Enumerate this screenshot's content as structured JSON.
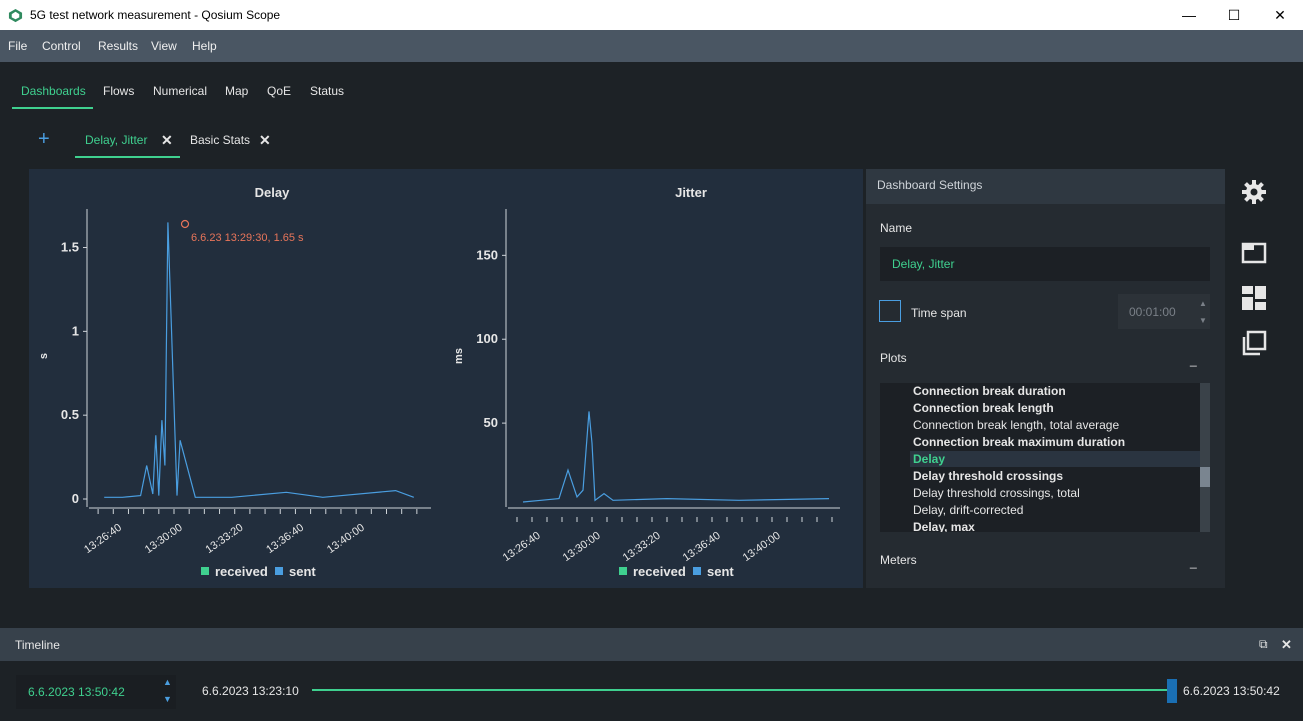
{
  "window": {
    "title": "5G test network measurement - Qosium Scope",
    "minimize": "—",
    "maximize": "☐",
    "close": "✕"
  },
  "menu": [
    "File",
    "Control",
    "Results",
    "View",
    "Help"
  ],
  "main_tabs": [
    "Dashboards",
    "Flows",
    "Numerical",
    "Map",
    "QoE",
    "Status"
  ],
  "dashboard_tabs": {
    "add": "+",
    "tabs": [
      "Delay, Jitter",
      "Basic Stats"
    ],
    "close_icon": "✕"
  },
  "charts": {
    "delay": {
      "title": "Delay",
      "ylabel": "s",
      "yticks": [
        "0",
        "0.5",
        "1",
        "1.5"
      ],
      "xticks": [
        "13:26:40",
        "13:30:00",
        "13:33:20",
        "13:36:40",
        "13:40:00"
      ],
      "tooltip": "6.6.23 13:29:30, 1.65 s"
    },
    "jitter": {
      "title": "Jitter",
      "ylabel": "ms",
      "yticks": [
        "50",
        "100",
        "150"
      ],
      "xticks": [
        "13:26:40",
        "13:30:00",
        "13:33:20",
        "13:36:40",
        "13:40:00"
      ]
    },
    "legend": {
      "received": "received",
      "sent": "sent"
    }
  },
  "chart_data": [
    {
      "type": "line",
      "title": "Delay",
      "ylabel": "s",
      "xlabel": "",
      "ylim": [
        0,
        1.7
      ],
      "series": [
        {
          "name": "received",
          "color": "#3fd08f",
          "values": []
        },
        {
          "name": "sent",
          "color": "#4a9ee0",
          "x": [
            "13:26:00",
            "13:27:00",
            "13:28:00",
            "13:28:20",
            "13:28:40",
            "13:28:50",
            "13:29:00",
            "13:29:10",
            "13:29:20",
            "13:29:30",
            "13:29:40",
            "13:30:00",
            "13:30:10",
            "13:31:00",
            "13:33:00",
            "13:36:00",
            "13:38:00",
            "13:42:00",
            "13:43:00"
          ],
          "values": [
            0.01,
            0.01,
            0.02,
            0.2,
            0.03,
            0.38,
            0.02,
            0.47,
            0.2,
            1.65,
            1.1,
            0.02,
            0.35,
            0.01,
            0.01,
            0.04,
            0.01,
            0.05,
            0.01
          ]
        }
      ]
    },
    {
      "type": "line",
      "title": "Jitter",
      "ylabel": "ms",
      "xlabel": "",
      "ylim": [
        0,
        180
      ],
      "series": [
        {
          "name": "received",
          "color": "#3fd08f",
          "values": []
        },
        {
          "name": "sent",
          "color": "#4a9ee0",
          "x": [
            "13:26:00",
            "13:27:00",
            "13:28:00",
            "13:28:30",
            "13:29:00",
            "13:29:20",
            "13:29:40",
            "13:29:50",
            "13:30:00",
            "13:30:30",
            "13:31:00",
            "13:34:00",
            "13:38:00",
            "13:43:00"
          ],
          "values": [
            3,
            4,
            5,
            22,
            6,
            10,
            57,
            38,
            4,
            8,
            4,
            5,
            4,
            5
          ]
        }
      ]
    }
  ],
  "settings": {
    "title": "Dashboard Settings",
    "name_label": "Name",
    "name_value": "Delay, Jitter",
    "timespan_label": "Time span",
    "timespan_value": "00:01:00",
    "plots_label": "Plots",
    "plots_collapse": "_",
    "plots": [
      {
        "label": "Connection break duration",
        "bold": true
      },
      {
        "label": "Connection break length",
        "bold": true
      },
      {
        "label": "Connection break length, total average",
        "bold": false
      },
      {
        "label": "Connection break maximum duration",
        "bold": true
      },
      {
        "label": "Delay",
        "bold": true,
        "selected": true
      },
      {
        "label": "Delay threshold crossings",
        "bold": true
      },
      {
        "label": "Delay threshold crossings, total",
        "bold": false
      },
      {
        "label": "Delay, drift-corrected",
        "bold": false
      },
      {
        "label": "Delay, max",
        "bold": true
      }
    ],
    "meters_label": "Meters",
    "meters_collapse": "_"
  },
  "side_icons": [
    "gear-icon",
    "window-icon",
    "dashboard-icon",
    "copy-icon"
  ],
  "timeline": {
    "title": "Timeline",
    "restore": "⧉",
    "close": "✕",
    "current": "6.6.2023 13:50:42",
    "start": "6.6.2023 13:23:10",
    "end": "6.6.2023 13:50:42",
    "position": 1.0
  }
}
